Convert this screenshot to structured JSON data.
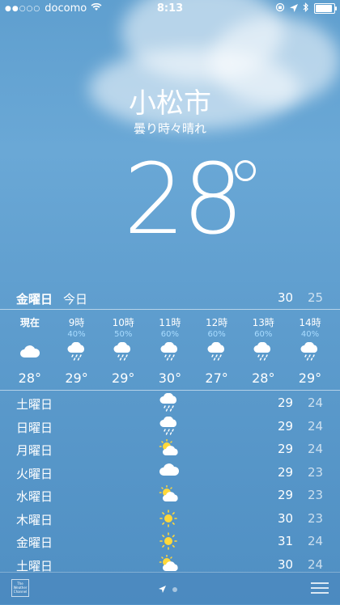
{
  "status_bar": {
    "carrier": "docomo",
    "time": "8:13",
    "signal_dots": "●●○○○"
  },
  "location": {
    "city": "小松市",
    "condition": "曇り時々晴れ",
    "temperature": "28"
  },
  "today": {
    "day": "金曜日",
    "label": "今日",
    "high": "30",
    "low": "25"
  },
  "hourly": [
    {
      "time": "現在",
      "precip": "",
      "icon": "cloudy-icon",
      "temp": "28°"
    },
    {
      "time": "9時",
      "precip": "40%",
      "icon": "rain-icon",
      "temp": "29°"
    },
    {
      "time": "10時",
      "precip": "50%",
      "icon": "rain-icon",
      "temp": "29°"
    },
    {
      "time": "11時",
      "precip": "60%",
      "icon": "rain-icon",
      "temp": "30°"
    },
    {
      "time": "12時",
      "precip": "60%",
      "icon": "rain-icon",
      "temp": "27°"
    },
    {
      "time": "13時",
      "precip": "60%",
      "icon": "rain-icon",
      "temp": "28°"
    },
    {
      "time": "14時",
      "precip": "40%",
      "icon": "rain-icon",
      "temp": "29°"
    }
  ],
  "daily": [
    {
      "day": "土曜日",
      "icon": "rain-icon",
      "high": "29",
      "low": "24"
    },
    {
      "day": "日曜日",
      "icon": "rain-icon",
      "high": "29",
      "low": "24"
    },
    {
      "day": "月曜日",
      "icon": "partly-cloudy-icon",
      "high": "29",
      "low": "24"
    },
    {
      "day": "火曜日",
      "icon": "cloudy-icon",
      "high": "29",
      "low": "23"
    },
    {
      "day": "水曜日",
      "icon": "partly-cloudy-icon",
      "high": "29",
      "low": "23"
    },
    {
      "day": "木曜日",
      "icon": "sunny-icon",
      "high": "30",
      "low": "23"
    },
    {
      "day": "金曜日",
      "icon": "sunny-icon",
      "high": "31",
      "low": "24"
    },
    {
      "day": "土曜日",
      "icon": "partly-cloudy-icon",
      "high": "30",
      "low": "24"
    }
  ],
  "footer": {
    "provider_logo": "The Weather Channel"
  }
}
